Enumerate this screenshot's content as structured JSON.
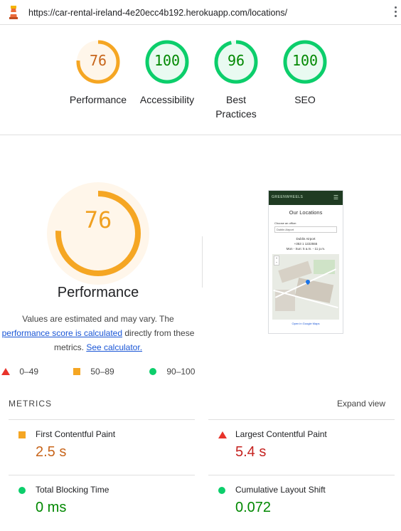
{
  "browser": {
    "url": "https://car-rental-ireland-4e20ecc4b192.herokuapp.com/locations/"
  },
  "categories": [
    {
      "label": "Performance",
      "score": 76,
      "color": "#f5a623",
      "bg": "#fff6ea",
      "text_color": "#c8651b"
    },
    {
      "label": "Accessibility",
      "score": 100,
      "color": "#0cce6b",
      "bg": "#e9faf1",
      "text_color": "#008800"
    },
    {
      "label": "Best Practices",
      "score": 96,
      "color": "#0cce6b",
      "bg": "#e9faf1",
      "text_color": "#008800"
    },
    {
      "label": "SEO",
      "score": 100,
      "color": "#0cce6b",
      "bg": "#e9faf1",
      "text_color": "#008800"
    }
  ],
  "performance": {
    "score": 76,
    "title": "Performance",
    "desc_before": "Values are estimated and may vary. The",
    "desc_link1": "performance score is calculated",
    "desc_middle": "directly from these metrics.",
    "desc_link2": "See calculator."
  },
  "legend": {
    "fail": "0–49",
    "average": "50–89",
    "pass": "90–100"
  },
  "screenshot": {
    "brand": "GREENWHEELS",
    "heading": "Our Locations",
    "select_label": "Choose an office:",
    "select_value": "Dublin Airport",
    "office_name": "Dublin Airport",
    "office_phone": "+353 1 1222555",
    "office_hours": "Mon - Sun: 5 a.m. - 11 p.m.",
    "map_link": "Open in Google Maps"
  },
  "metrics": {
    "header": "METRICS",
    "expand_label": "Expand view",
    "fcp": {
      "name": "First Contentful Paint",
      "value": "2.5 s",
      "rating": "average"
    },
    "lcp": {
      "name": "Largest Contentful Paint",
      "value": "5.4 s",
      "rating": "fail"
    },
    "tbt": {
      "name": "Total Blocking Time",
      "value": "0 ms",
      "rating": "pass"
    },
    "cls": {
      "name": "Cumulative Layout Shift",
      "value": "0.072",
      "rating": "pass"
    }
  },
  "colors": {
    "fail": "#e8332a",
    "average": "#f5a623",
    "pass": "#0cce6b",
    "link": "#1a56d6",
    "fail_text": "#c5221f",
    "average_text": "#c8651b",
    "pass_text": "#008800"
  }
}
